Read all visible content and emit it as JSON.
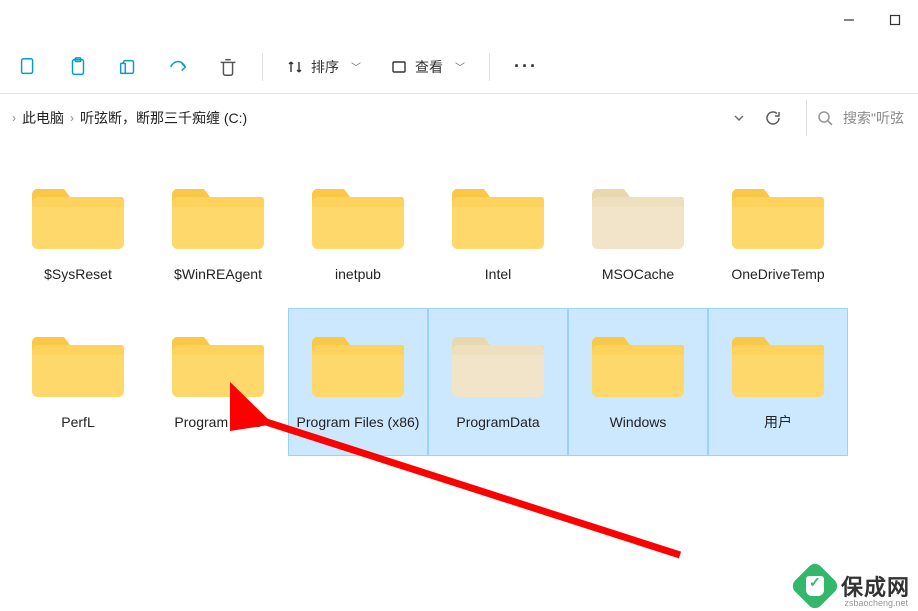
{
  "window": {
    "minimize": "—",
    "maximize": "▢"
  },
  "toolbar": {
    "sort_label": "排序",
    "view_label": "查看"
  },
  "breadcrumb": {
    "items": [
      "此电脑",
      "听弦断，断那三千痴缠 (C:)"
    ]
  },
  "search": {
    "placeholder": "搜索\"听弦"
  },
  "folders": [
    {
      "label": "$SysReset",
      "selected": false,
      "hidden": false
    },
    {
      "label": "$WinREAgent",
      "selected": false,
      "hidden": false
    },
    {
      "label": "inetpub",
      "selected": false,
      "hidden": false
    },
    {
      "label": "Intel",
      "selected": false,
      "hidden": false
    },
    {
      "label": "MSOCache",
      "selected": false,
      "hidden": true
    },
    {
      "label": "OneDriveTemp",
      "selected": false,
      "hidden": false
    },
    {
      "label": "PerfL",
      "selected": false,
      "hidden": false,
      "truncated": true
    },
    {
      "label": "Program Files",
      "selected": false,
      "hidden": false
    },
    {
      "label": "Program Files (x86)",
      "selected": true,
      "hidden": false
    },
    {
      "label": "ProgramData",
      "selected": true,
      "hidden": true
    },
    {
      "label": "Windows",
      "selected": true,
      "hidden": false
    },
    {
      "label": "用户",
      "selected": true,
      "hidden": false
    }
  ],
  "watermark": {
    "text": "保成网",
    "url": "zsbaocheng.net"
  }
}
